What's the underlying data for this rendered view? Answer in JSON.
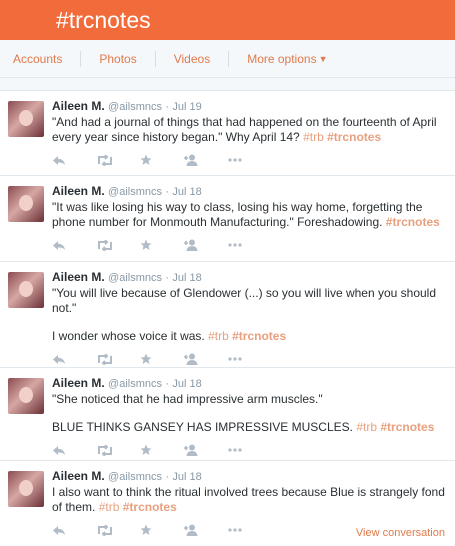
{
  "header": {
    "title": "#trcnotes"
  },
  "nav": {
    "accounts": "Accounts",
    "photos": "Photos",
    "videos": "Videos",
    "more": "More options"
  },
  "tweets": [
    {
      "name": "Aileen M.",
      "handle": "@ailsmncs",
      "date": "Jul 19",
      "line1": "\"And had a journal of things that had happened on the fourteenth of April every year since history began.\" Why April 14?",
      "tag1": "#trb",
      "tag2": "#trcnotes"
    },
    {
      "name": "Aileen M.",
      "handle": "@ailsmncs",
      "date": "Jul 18",
      "line1": "\"It was like losing his way to class, losing his way home, forgetting the phone number for Monmouth Manufacturing.\" Foreshadowing.",
      "tag2": "#trcnotes"
    },
    {
      "name": "Aileen M.",
      "handle": "@ailsmncs",
      "date": "Jul 18",
      "line1": "\"You will live because of Glendower (...) so you will live when you should not.\"",
      "line2": "I wonder whose voice it was.",
      "tag1": "#trb",
      "tag2": "#trcnotes"
    },
    {
      "name": "Aileen M.",
      "handle": "@ailsmncs",
      "date": "Jul 18",
      "line1": "\"She noticed that he had impressive arm muscles.\"",
      "line2": "BLUE THINKS GANSEY HAS IMPRESSIVE MUSCLES.",
      "tag1": "#trb",
      "tag2": "#trcnotes"
    },
    {
      "name": "Aileen M.",
      "handle": "@ailsmncs",
      "date": "Jul 18",
      "line1": "I also want to think the ritual involved trees because Blue is strangely fond of them.",
      "tag1": "#trb",
      "tag2": "#trcnotes",
      "view_conversation": "View conversation"
    }
  ],
  "icons": [
    "reply-icon",
    "retweet-icon",
    "favorite-icon",
    "follow-icon",
    "more-icon"
  ],
  "colors": {
    "brand": "#f26c3b",
    "link": "#e07a4b",
    "hashtag": "#e8a07e"
  }
}
